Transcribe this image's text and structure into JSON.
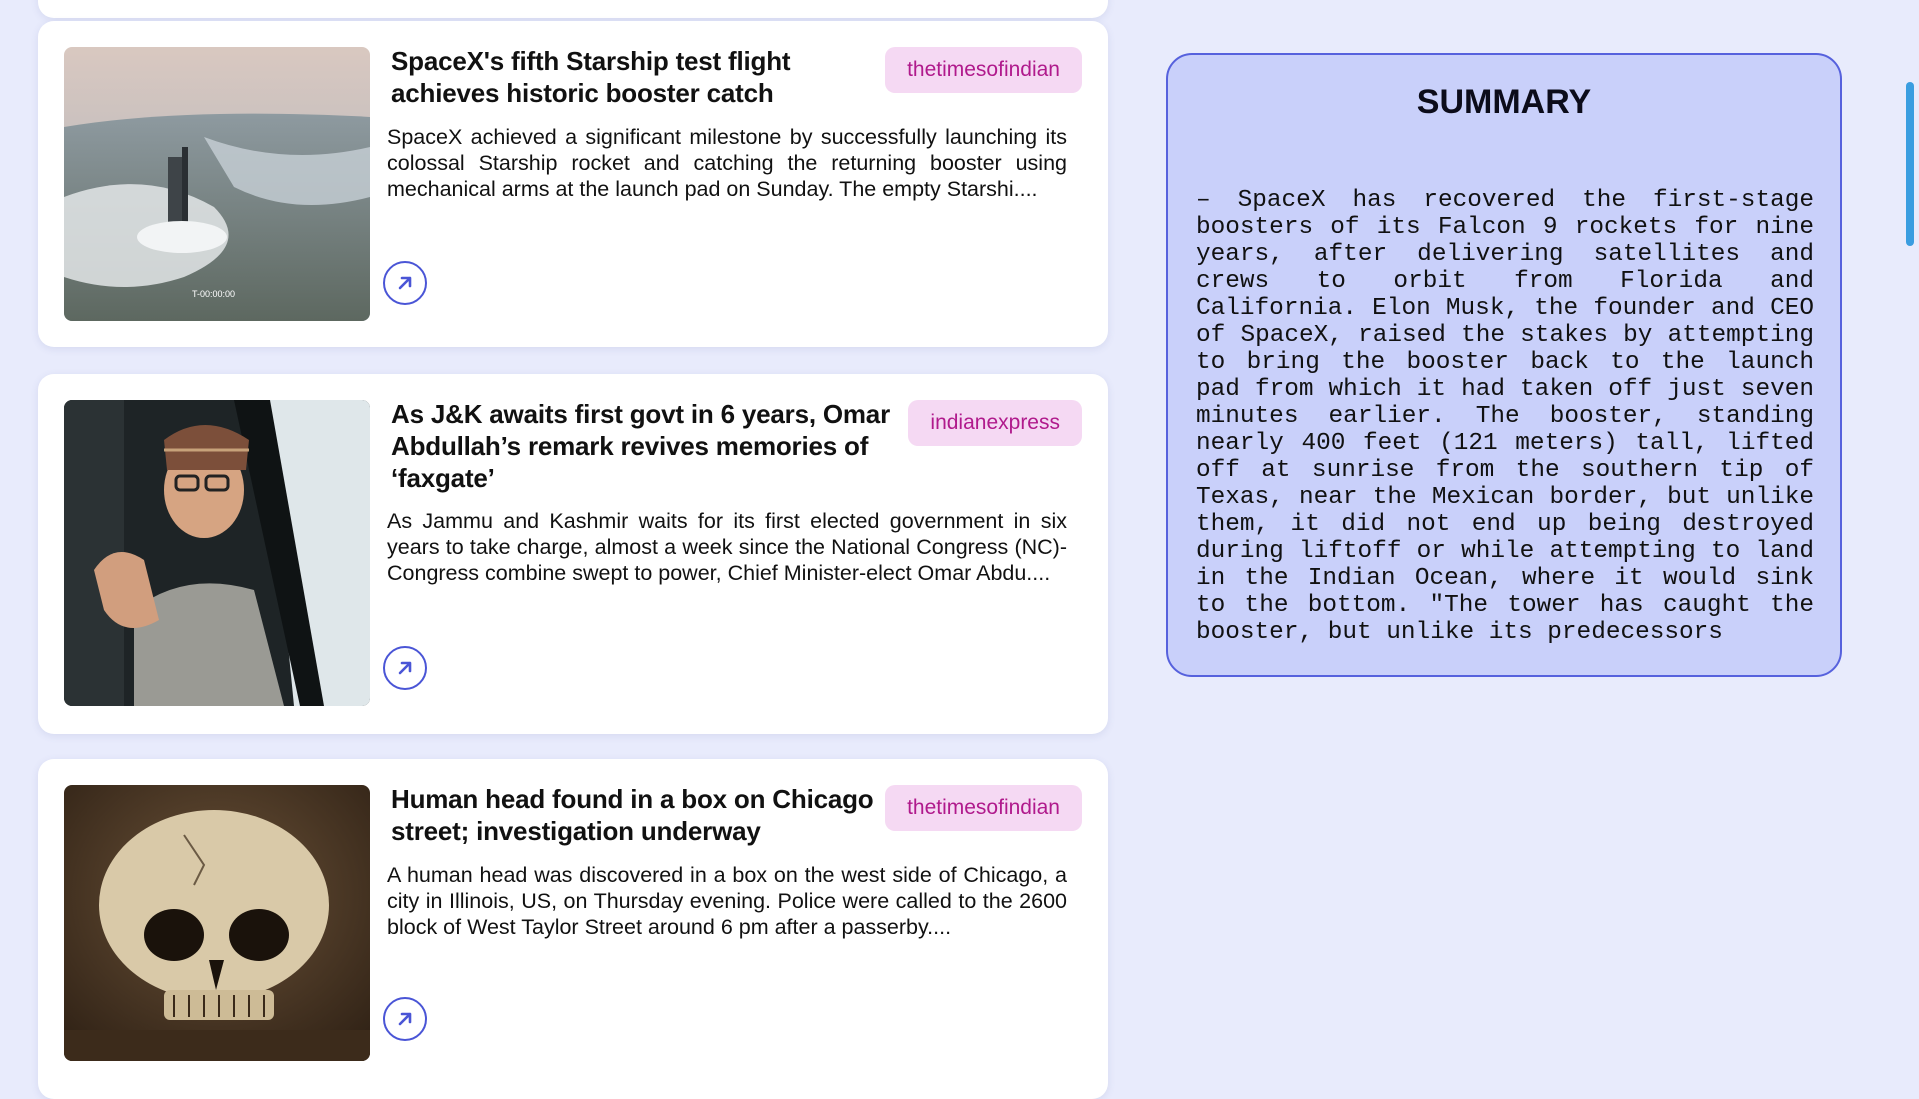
{
  "news": [
    {
      "title": "SpaceX's fifth Starship test flight achieves historic booster catch",
      "source": "thetimesofindian",
      "description": "SpaceX achieved a significant milestone by successfully launching its colossal Starship rocket and catching the returning booster using mechanical arms at the launch pad on Sunday. The empty Starshi....",
      "image": "starship-launch-photo"
    },
    {
      "title": "As J&K awaits first govt in 6 years, Omar Abdullah’s remark revives memories of ‘faxgate’",
      "source": "indianexpress",
      "description": "As Jammu and Kashmir waits for its first elected government in six years to take charge, almost a week since the National Congress (NC)-Congress combine swept to power, Chief Minister-elect Omar Abdu....",
      "image": "politician-car-photo"
    },
    {
      "title": "Human head found in a box on Chicago street; investigation underway",
      "source": "thetimesofindian",
      "description": "A human head was discovered in a box on the west side of Chicago, a city in Illinois, US, on Thursday evening. Police were called to the 2600 block of West Taylor Street around 6 pm after a passerby....",
      "image": "skull-photo"
    }
  ],
  "summary": {
    "title": "SUMMARY",
    "text": "– SpaceX has recovered the first-stage boosters of its Falcon 9 rockets for nine years, after delivering satellites and crews to orbit from Florida and California. Elon Musk, the founder and CEO of SpaceX, raised the stakes by attempting to bring the booster back to the launch pad from which it had taken off just seven minutes earlier. The booster, standing nearly 400 feet (121 meters) tall, lifted off at sunrise from the southern tip of Texas, near the Mexican border, but unlike them, it did not end up being destroyed during liftoff or while attempting to land in the Indian Ocean, where it would sink to the bottom. \"The tower has caught the booster, but unlike its predecessors"
  },
  "colors": {
    "background": "#e8ebfc",
    "summary_panel": "#c9d0fa",
    "accent": "#4a55d6",
    "tag_bg": "#f5d9f3",
    "tag_text": "#b01a8c"
  },
  "icons": {
    "open_article": "arrow-up-right-icon"
  }
}
